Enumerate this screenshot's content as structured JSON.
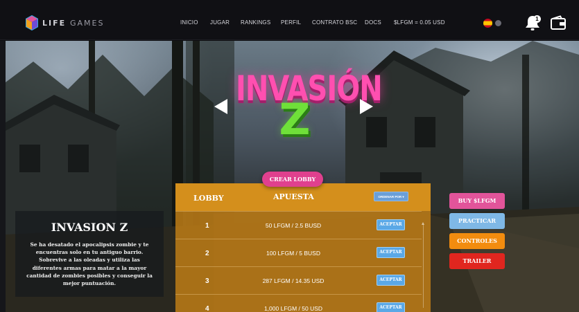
{
  "brand": {
    "name_bold": "LIFE",
    "name_light": "GAMES"
  },
  "nav": {
    "items": [
      "INICIO",
      "JUGAR",
      "RANKINGS",
      "PERFIL",
      "CONTRATO BSC",
      "DOCS"
    ],
    "price": "$LFGM = 0.05 USD"
  },
  "header": {
    "notification_count": "1",
    "language_flag": "spain-flag-icon"
  },
  "hero": {
    "title_word": "INVASIÓN",
    "title_letter": "Z"
  },
  "lobby": {
    "create_label": "CREAR LOBBY",
    "col_lobby": "LOBBY",
    "col_bet": "APUESTA",
    "sort_label": "ORDENAR POR ▾",
    "accept_label": "ACEPTAR",
    "rows": [
      {
        "num": "1",
        "bet": "50 LFGM / 2.5 BUSD"
      },
      {
        "num": "2",
        "bet": "100 LFGM / 5 BUSD"
      },
      {
        "num": "3",
        "bet": "287 LFGM / 14.35 USD"
      },
      {
        "num": "4",
        "bet": "1,000 LFGM / 50 USD"
      }
    ]
  },
  "info": {
    "title": "INVASION Z",
    "description": "Se ha desatado el apocalipsis zombie y te encuentras solo en tu antiguo barrio. Sobrevive a las oleadas y utiliza las diferentes armas para matar a la mayor cantidad de zombies posibles y conseguir la mejor puntuación."
  },
  "actions": {
    "buy": "BUY $LFGM",
    "practice": "PRACTICAR",
    "controls": "CONTROLES",
    "trailer": "TRAILER"
  },
  "colors": {
    "buy": "#e2549a",
    "practice": "#7fb8e6",
    "controls": "#f28c0f",
    "trailer": "#e0261f",
    "lobby_header": "#d48f1c",
    "crear": "#e0408e"
  }
}
